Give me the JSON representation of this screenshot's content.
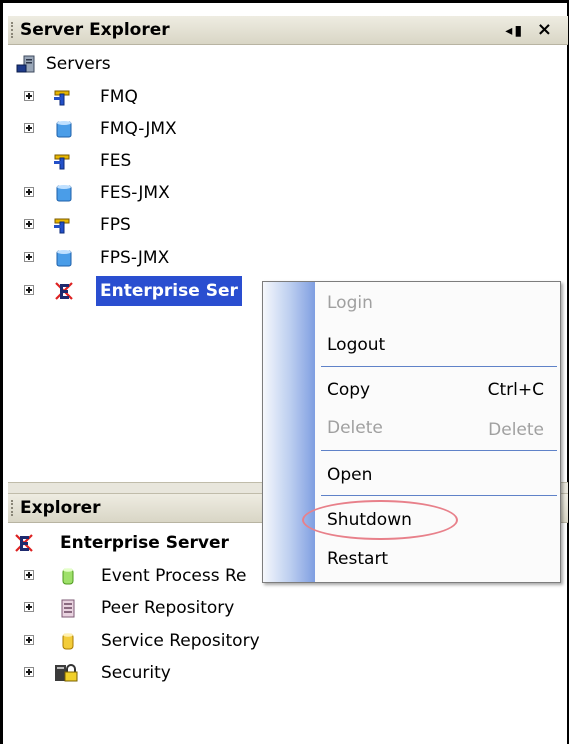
{
  "server_explorer": {
    "title": "Server Explorer",
    "pin_glyph": "◂▮",
    "close_glyph": "×",
    "root_label": "Servers",
    "items": [
      {
        "label": "FMQ",
        "icon": "plug-icon",
        "expandable": true
      },
      {
        "label": "FMQ-JMX",
        "icon": "cylinder-icon",
        "expandable": true
      },
      {
        "label": "FES",
        "icon": "plug-icon",
        "expandable": false
      },
      {
        "label": "FES-JMX",
        "icon": "cylinder-icon",
        "expandable": true
      },
      {
        "label": "FPS",
        "icon": "plug-icon",
        "expandable": true
      },
      {
        "label": "FPS-JMX",
        "icon": "cylinder-icon",
        "expandable": true
      },
      {
        "label": "Enterprise Ser",
        "icon": "enterprise-server-icon",
        "expandable": true,
        "selected": true
      }
    ]
  },
  "explorer": {
    "title": "Explorer",
    "root_label": "Enterprise Server",
    "items": [
      {
        "label": "Event Process Re",
        "icon": "green-cylinder-icon"
      },
      {
        "label": "Peer Repository",
        "icon": "peer-repository-icon"
      },
      {
        "label": "Service Repository",
        "icon": "yellow-cylinder-icon"
      },
      {
        "label": "Security",
        "icon": "security-lock-icon"
      }
    ]
  },
  "context_menu": {
    "login": "Login",
    "logout": "Logout",
    "copy": "Copy",
    "copy_shortcut": "Ctrl+C",
    "delete": "Delete",
    "delete_shortcut": "Delete",
    "open": "Open",
    "shutdown": "Shutdown",
    "restart": "Restart"
  },
  "colors": {
    "selection": "#2a4ed0",
    "highlight_ellipse": "#e8808a",
    "menu_strip": "#7f9ee1"
  }
}
